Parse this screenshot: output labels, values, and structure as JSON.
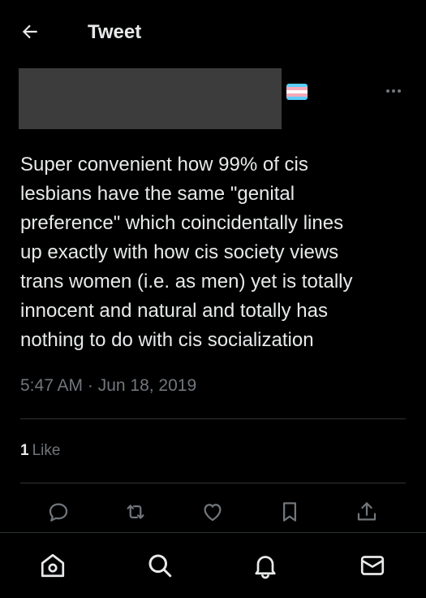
{
  "header": {
    "title": "Tweet",
    "back_icon": "arrow-left-icon"
  },
  "author": {
    "name_redacted": true,
    "badge_emoji": "transgender-flag-emoji",
    "badge_colors": [
      "#5bcefa",
      "#f5a9b8",
      "#ffffff",
      "#f5a9b8",
      "#5bcefa"
    ]
  },
  "tweet": {
    "text": "Super convenient how 99% of cis\nlesbians have the same \"genital\npreference\" which coincidentally lines\nup exactly with how cis society views\ntrans women (i.e. as men) yet is totally\ninnocent and natural and totally has\nnothing to do with cis socialization",
    "timestamp": "5:47 AM · Jun 18, 2019",
    "like_count": "1",
    "like_label": "Like"
  },
  "actions": [
    {
      "icon": "reply-icon"
    },
    {
      "icon": "retweet-icon"
    },
    {
      "icon": "like-heart-icon"
    },
    {
      "icon": "bookmark-icon"
    },
    {
      "icon": "share-icon"
    }
  ],
  "bottom_nav": [
    {
      "icon": "home-icon"
    },
    {
      "icon": "search-icon"
    },
    {
      "icon": "notifications-bell-icon"
    },
    {
      "icon": "messages-mail-icon"
    }
  ],
  "colors": {
    "background": "#000000",
    "text_primary": "#e7e9ea",
    "text_secondary": "#71767b",
    "divider": "#2f3336"
  }
}
